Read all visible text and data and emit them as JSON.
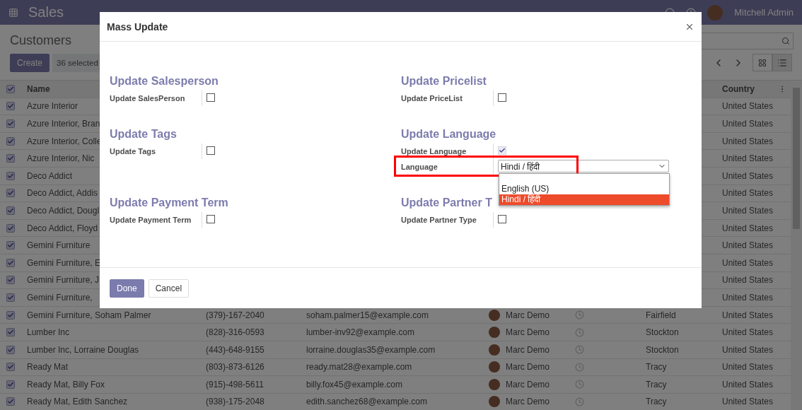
{
  "navbar": {
    "app": "Sales",
    "user": "Mitchell Admin"
  },
  "control_panel": {
    "title": "Customers",
    "create": "Create",
    "selection": "36 selected"
  },
  "table": {
    "all_selected": true,
    "columns": [
      "Name",
      "Country"
    ],
    "rows": [
      {
        "selected": true,
        "name": "Azure Interior",
        "country": "United States"
      },
      {
        "selected": true,
        "name": "Azure Interior, Bran",
        "country": "United States"
      },
      {
        "selected": true,
        "name": "Azure Interior, Colle",
        "country": "United States"
      },
      {
        "selected": true,
        "name": "Azure Interior, Nic",
        "country": "United States"
      },
      {
        "selected": true,
        "name": "Deco Addict",
        "country": "United States"
      },
      {
        "selected": true,
        "name": "Deco Addict, Addis",
        "country": "United States"
      },
      {
        "selected": true,
        "name": "Deco Addict, Dougl",
        "country": "United States"
      },
      {
        "selected": true,
        "name": "Deco Addict, Floyd",
        "country": "United States"
      },
      {
        "selected": true,
        "name": "Gemini Furniture",
        "country": "United States"
      },
      {
        "selected": true,
        "name": "Gemini Furniture, E",
        "country": "United States"
      },
      {
        "selected": true,
        "name": "Gemini Furniture, J",
        "country": "United States"
      },
      {
        "selected": true,
        "name": "Gemini Furniture,",
        "country": "United States"
      },
      {
        "selected": true,
        "name": "Gemini Furniture, Soham Palmer",
        "phone": "(379)-167-2040",
        "email": "soham.palmer15@example.com",
        "salesperson": "Marc Demo",
        "city": "Fairfield",
        "country": "United States"
      },
      {
        "selected": true,
        "name": "Lumber Inc",
        "phone": "(828)-316-0593",
        "email": "lumber-inv92@example.com",
        "salesperson": "Marc Demo",
        "city": "Stockton",
        "country": "United States"
      },
      {
        "selected": true,
        "name": "Lumber Inc, Lorraine Douglas",
        "phone": "(443)-648-9155",
        "email": "lorraine.douglas35@example.com",
        "salesperson": "Marc Demo",
        "city": "Stockton",
        "country": "United States"
      },
      {
        "selected": true,
        "name": "Ready Mat",
        "phone": "(803)-873-6126",
        "email": "ready.mat28@example.com",
        "salesperson": "Marc Demo",
        "city": "Tracy",
        "country": "United States"
      },
      {
        "selected": true,
        "name": "Ready Mat, Billy Fox",
        "phone": "(915)-498-5611",
        "email": "billy.fox45@example.com",
        "salesperson": "Marc Demo",
        "city": "Tracy",
        "country": "United States"
      },
      {
        "selected": true,
        "name": "Ready Mat, Edith Sanchez",
        "phone": "(938)-175-2048",
        "email": "edith.sanchez68@example.com",
        "salesperson": "Marc Demo",
        "city": "Tracy",
        "country": "United States"
      }
    ]
  },
  "dialog": {
    "title": "Mass Update",
    "groups": [
      {
        "title": "Update Salesperson",
        "fields": [
          {
            "kind": "checkbox",
            "label": "Update SalesPerson",
            "checked": false
          }
        ]
      },
      {
        "title": "Update Pricelist",
        "fields": [
          {
            "kind": "checkbox",
            "label": "Update PriceList",
            "checked": false
          }
        ]
      },
      {
        "title": "Update Tags",
        "fields": [
          {
            "kind": "checkbox",
            "label": "Update Tags",
            "checked": false
          }
        ]
      },
      {
        "title": "Update Language",
        "fields": [
          {
            "kind": "checkbox",
            "label": "Update Language",
            "checked": true
          },
          {
            "kind": "select",
            "label": "Language",
            "value": "Hindi / हिंदी",
            "highlighted": true,
            "options": [
              {
                "label": "English (US)",
                "selected": false
              },
              {
                "label": "Hindi / हिंदी",
                "selected": true
              }
            ]
          }
        ]
      },
      {
        "title": "Update Payment Term",
        "fields": [
          {
            "kind": "checkbox",
            "label": "Update Payment Term",
            "checked": false
          }
        ]
      },
      {
        "title": "Update Partner T",
        "fields": [
          {
            "kind": "checkbox",
            "label": "Update Partner Type",
            "checked": false
          }
        ]
      }
    ],
    "buttons": [
      {
        "label": "Done",
        "kind": "primary"
      },
      {
        "label": "Cancel",
        "kind": "secondary"
      }
    ]
  }
}
